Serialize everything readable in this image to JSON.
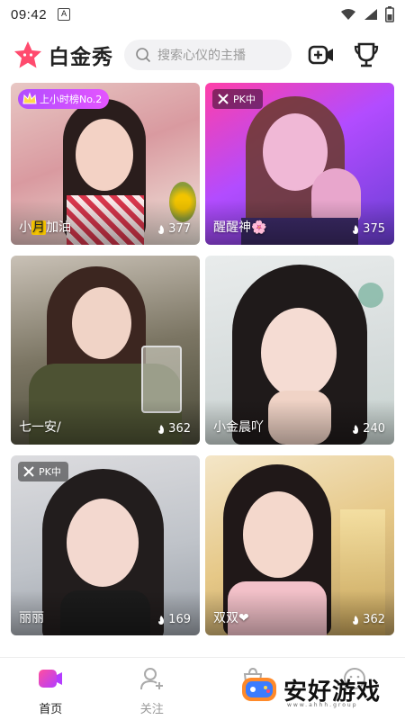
{
  "status_bar": {
    "time": "09:42",
    "notif_letter": "A"
  },
  "header": {
    "brand": "白金秀",
    "search_placeholder": "搜索心仪的主播",
    "colors": {
      "accent": "#ff3b6b",
      "search_bg": "#f2f2f4"
    }
  },
  "cards": [
    {
      "name_a": "小",
      "name_b": "月",
      "name_c": "加油",
      "count": "377",
      "badge_type": "rank",
      "badge": "上小时榜No.2",
      "palette": "warm-pink"
    },
    {
      "name": "醒醒神🌸",
      "count": "375",
      "badge_type": "pk",
      "badge": "PK中",
      "palette": "neon-purple"
    },
    {
      "name": "七一安/",
      "count": "362",
      "badge_type": "none",
      "palette": "green-dark"
    },
    {
      "name": "小金晨吖",
      "count": "240",
      "badge_type": "none",
      "palette": "grey-light"
    },
    {
      "name": "丽丽",
      "count": "169",
      "badge_type": "pk",
      "badge": "PK中",
      "palette": "grey-cool"
    },
    {
      "name": "双双❤",
      "count": "362",
      "badge_type": "none",
      "palette": "warm-gold"
    }
  ],
  "nav": [
    {
      "label": "首页",
      "active": true,
      "icon": "home-icon"
    },
    {
      "label": "关注",
      "active": false,
      "icon": "follow-icon"
    },
    {
      "label": "",
      "active": false,
      "icon": "bag-icon"
    },
    {
      "label": "",
      "active": false,
      "icon": "face-icon"
    }
  ],
  "watermark": {
    "text": "安好游戏",
    "sub": "www.ahhh.group"
  }
}
